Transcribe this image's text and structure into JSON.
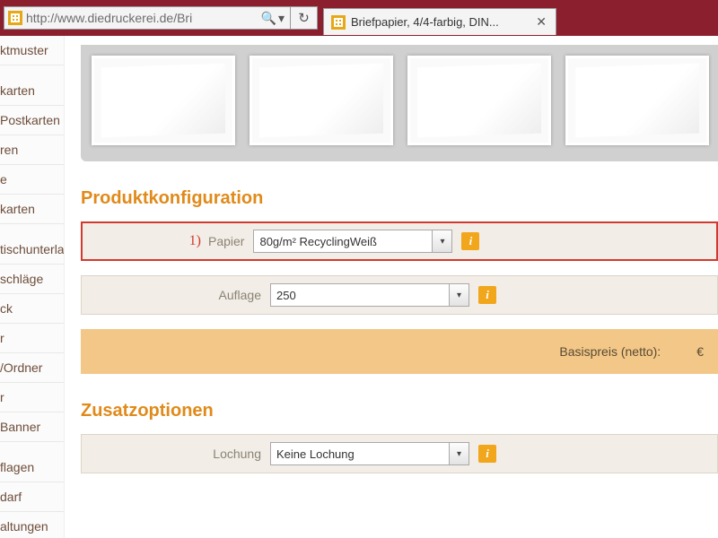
{
  "browser": {
    "url": "http://www.diedruckerei.de/Bri",
    "tab_title": "Briefpapier, 4/4-farbig, DIN..."
  },
  "sidebar": {
    "items": [
      "ktmuster",
      "karten",
      "Postkarten",
      "ren",
      "e",
      "karten",
      "tischunterlagen",
      "schläge",
      "ck",
      "r",
      "/Ordner",
      "r",
      "Banner",
      "flagen",
      "darf",
      "altungen"
    ]
  },
  "config": {
    "heading": "Produktkonfiguration",
    "rows": [
      {
        "marker": "1)",
        "label": "Papier",
        "value": "80g/m² RecyclingWeiß"
      },
      {
        "marker": "",
        "label": "Auflage",
        "value": "250"
      }
    ],
    "price_label": "Basispreis (netto):",
    "price_currency": "€"
  },
  "extras": {
    "heading": "Zusatzoptionen",
    "rows": [
      {
        "label": "Lochung",
        "value": "Keine Lochung"
      }
    ]
  }
}
